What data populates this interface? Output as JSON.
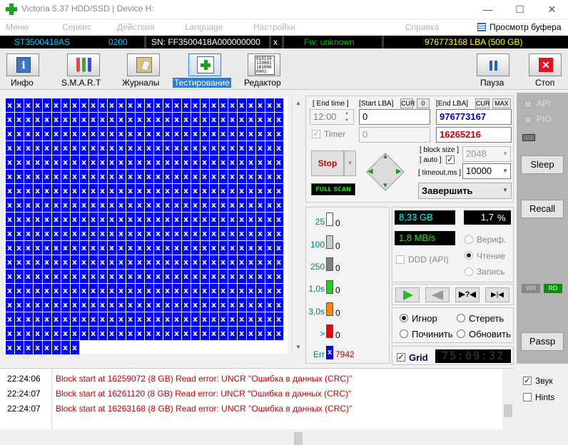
{
  "window": {
    "title": "Victoria 5.37 HDD/SSD | Device H:",
    "min": "—",
    "max": "☐",
    "close": "✕"
  },
  "menu": [
    "Меню",
    "Сервис",
    "Действия",
    "Language",
    "Настройки",
    "Справка"
  ],
  "buffer_label": "Просмотр буфера",
  "device": {
    "model": "ST3500418AS",
    "code": "0200",
    "serial": "SN: FF3500418A000000000",
    "x": "x",
    "fw": "Fw: unknown",
    "lba": "976773168 LBA (500 GB)"
  },
  "toolbar": {
    "info": "Инфо",
    "smart": "S.M.A.R.T",
    "journals": "Журналы",
    "testing": "Тестирование",
    "editor": "Редактор",
    "pause": "Пауза",
    "stop": "Стоп",
    "editor_icon": "010110\n110001\n101000\n0001"
  },
  "block_char": "x",
  "test": {
    "end_time_label": "[ End time ]",
    "start_lba_label": "[Start LBA]",
    "cur": "CUR",
    "zero": "0",
    "end_lba_label": "[End LBA]",
    "cur2": "CUR",
    "max": "MAX",
    "time": "12:00",
    "start_lba": "0",
    "end_lba": "976773167",
    "timer_label": "Timer",
    "timer_value": "0",
    "block_count": "16265216",
    "stop": "Stop",
    "fullscan": "FULL SCAN",
    "block_size_label": "[ block size ]",
    "auto_label": "[ auto ]",
    "block_size": "2048",
    "timeout_label": "[ timeout,ms ]",
    "timeout": "10000",
    "finish": "Завершить"
  },
  "stats": {
    "t25": "25",
    "t100": "100",
    "t250": "250",
    "t1s": "1,0s",
    "t3s": "3,0s",
    "tgt": ">",
    "err": "Err",
    "c25": "0",
    "c100": "0",
    "c250": "0",
    "c1s": "0",
    "c3s": "0",
    "cgt": "0",
    "cerr": "7942"
  },
  "progress": {
    "size": "8,33 GB",
    "pct": "1,7",
    "pct_sym": "%",
    "speed": "1,8 MB/s",
    "verify": "Вериф.",
    "read": "Чтение",
    "write": "Запись",
    "ddd": "DDD (API)"
  },
  "actions": {
    "ignore": "Игнор",
    "erase": "Стереть",
    "repair": "Починить",
    "refresh": "Обновить",
    "grid": "Grid",
    "timer": "75:09:32"
  },
  "right": {
    "api": "API",
    "pio": "PIO",
    "sleep": "Sleep",
    "recall": "Recall",
    "wr": "WR",
    "rd": "RD",
    "passp": "Passp",
    "sound": "Звук",
    "hints": "Hints"
  },
  "log": [
    {
      "time": "22:24:06",
      "msg": "Block start at 16259072 (8 GB) Read error: UNCR \"Ошибка в данных (CRC)\""
    },
    {
      "time": "22:24:07",
      "msg": "Block start at 16261120 (8 GB) Read error: UNCR \"Ошибка в данных (CRC)\""
    },
    {
      "time": "22:24:07",
      "msg": "Block start at 16263168 (8 GB) Read error: UNCR \"Ошибка в данных (CRC)\""
    }
  ],
  "colors": {
    "block": "#0000ff",
    "log_red": "#cc0000",
    "fw": "#00c000",
    "lba": "#ffff00",
    "cyan": "#00ccff"
  }
}
